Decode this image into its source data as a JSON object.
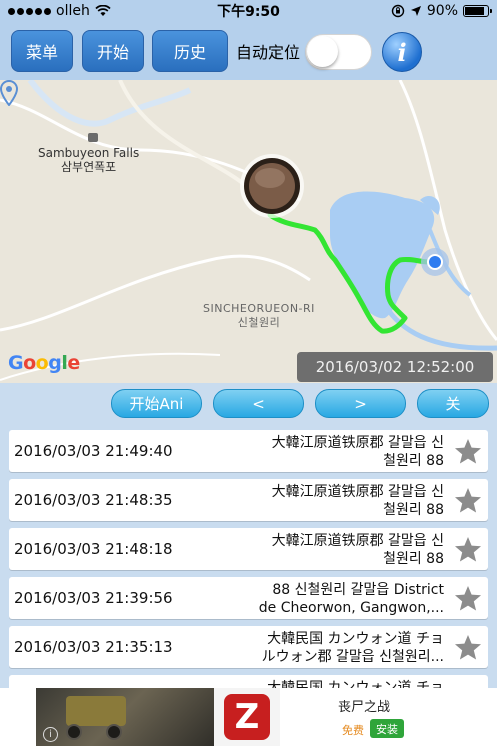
{
  "status": {
    "carrier": "olleh",
    "time": "下午9:50",
    "battery": "90%",
    "battery_level": 0.9
  },
  "toolbar": {
    "menu_label": "菜单",
    "start_label": "开始",
    "history_label": "历史",
    "auto_locate_label": "自动定位",
    "auto_locate_on": false,
    "info_label": "i"
  },
  "map": {
    "place1_en": "Sambuyeon Falls",
    "place1_ko": "삼부연폭포",
    "place2_en": "SINCHEORUEON-RI",
    "place2_ko": "신철원리",
    "timestamp": "2016/03/02 12:52:00",
    "route_color": "#33e533",
    "water_color": "#a9cdf3"
  },
  "controls": {
    "start_ani": "开始Ani",
    "prev": "<",
    "next": ">",
    "close": "关"
  },
  "list": [
    {
      "time": "2016/03/03 21:49:40",
      "address": "大韓江原道铁原郡 갈말읍 신\n철원리 88"
    },
    {
      "time": "2016/03/03 21:48:35",
      "address": "大韓江原道铁原郡 갈말읍 신\n철원리 88"
    },
    {
      "time": "2016/03/03 21:48:18",
      "address": "大韓江原道铁原郡 갈말읍 신\n철원리 88"
    },
    {
      "time": "2016/03/03 21:39:56",
      "address": "88 신철원리 갈말읍 District\nde Cheorwon, Gangwon,..."
    },
    {
      "time": "2016/03/03 21:35:13",
      "address": "大韓民国 カンウォン道 チョ\nルウォン郡 갈말읍 신철원리..."
    },
    {
      "time": "",
      "address": "大韓民国 カンウォン道 チョ"
    }
  ],
  "ad": {
    "title": "丧尸之战",
    "free": "免费",
    "install": "安装"
  }
}
